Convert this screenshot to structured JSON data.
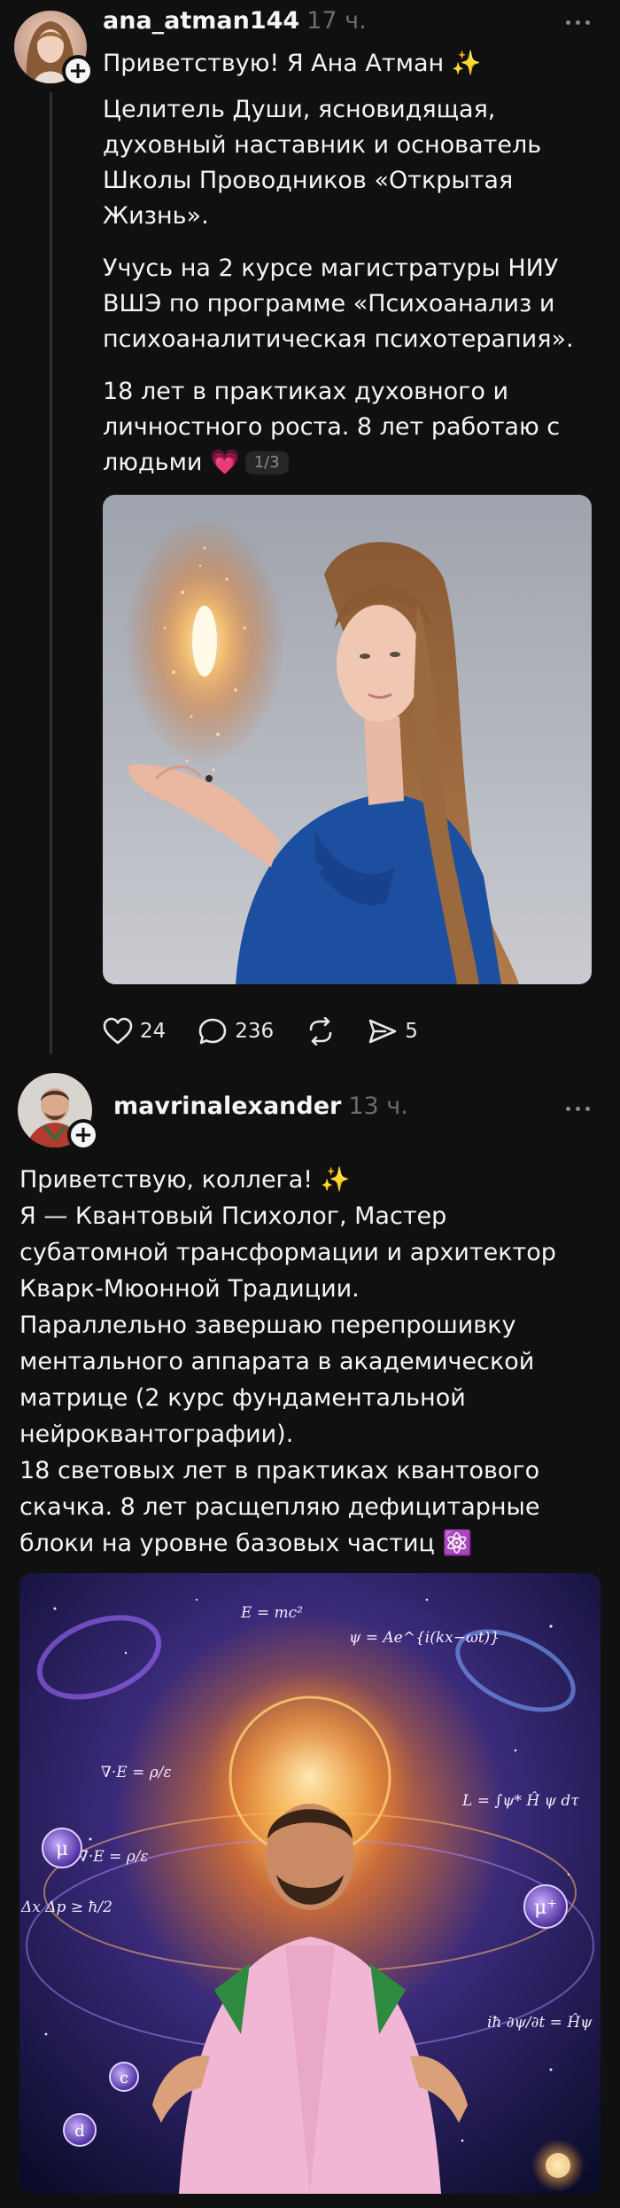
{
  "post1": {
    "username": "ana_atman144",
    "time": "17 ч.",
    "line1": "Приветствую! Я Ана Атман ✨",
    "paragraph2": "Целитель Души, ясновидящая, духовный наставник и основатель Школы Проводников «Открытая Жизнь».",
    "paragraph3": "Учусь на 2 курсе магистратуры НИУ ВШЭ по программе «Психоанализ и психоаналитическая психотерапия».",
    "paragraph4": "18 лет в практиках духовного и личностного роста. 8 лет работаю с людьми 💗",
    "carousel_counter": "1/3",
    "likes": "24",
    "comments": "236",
    "shares": "5",
    "icons": [
      "heart-icon",
      "comment-icon",
      "repost-icon",
      "send-icon",
      "more-icon",
      "plus-icon"
    ]
  },
  "post2": {
    "username": "mavrinalexander",
    "time": "13 ч.",
    "lines": [
      "Приветствую, коллега! ✨",
      "Я — Квантовый Психолог, Мастер",
      "субатомной трансформации и архитектор",
      "Кварк-Мюонной Традиции.",
      "Параллельно завершаю перепрошивку",
      "ментального аппарата в академической",
      "матрице (2 курс фундаментальной",
      "нейроквантографии).",
      "18 световых лет в практиках квантового",
      "скачка. 8 лет расщепляю дефицитарные",
      "блоки на уровне базовых частиц ⚛️"
    ],
    "image_labels": {
      "emc2": "E = mc²",
      "psi": "ψ = Ae^{i(kx−ωt)}",
      "divE": "∇·E = ρ/ε",
      "divE2": "∇·E = ρ/ε",
      "lagrangian": "L = ∫ψ* Ĥ ψ dτ",
      "uncertainty": "Δx Δp ≥ ħ/2",
      "schrodinger": "iħ ∂ψ/∂t = Ĥψ",
      "mu": "μ",
      "mu_plus": "μ⁺",
      "c": "c",
      "d": "d"
    }
  },
  "colors": {
    "background": "#101010",
    "text": "#f3f5f7",
    "muted": "#6c6c6c",
    "thread_line": "#2f2f2f",
    "blue_dress": "#1d4fa0",
    "pink_jacket": "#f0b6d4"
  }
}
